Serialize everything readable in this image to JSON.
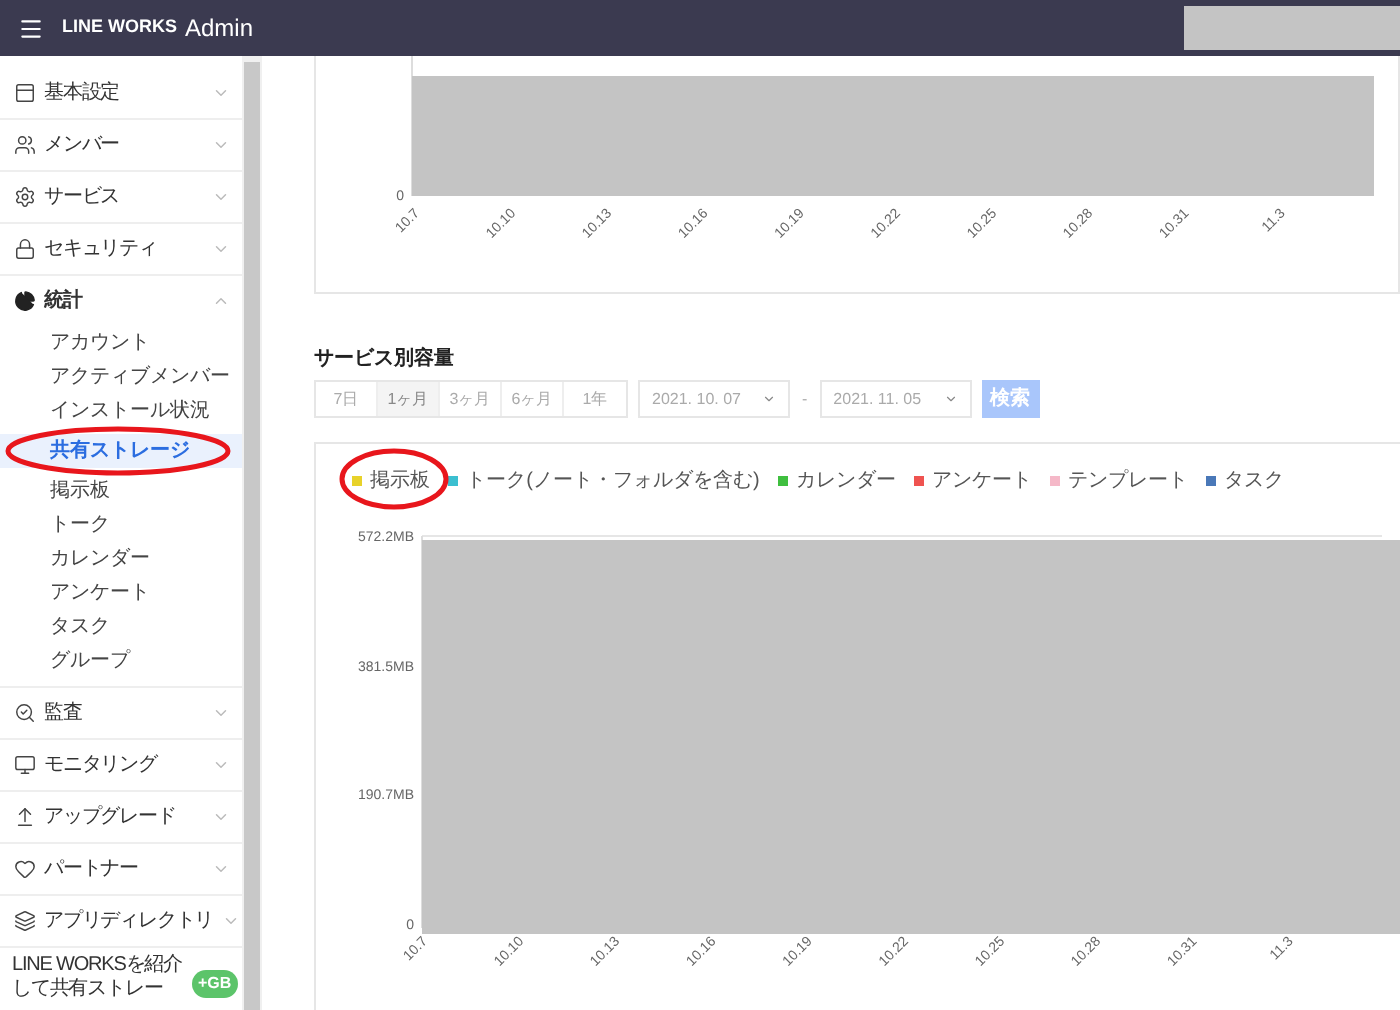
{
  "header": {
    "brand": "LINE WORKS",
    "suffix": "Admin"
  },
  "sidebar": {
    "items": [
      {
        "label": "基本設定",
        "expanded": false
      },
      {
        "label": "メンバー",
        "expanded": false
      },
      {
        "label": "サービス",
        "expanded": false
      },
      {
        "label": "セキュリティ",
        "expanded": false
      },
      {
        "label": "統計",
        "expanded": true,
        "children": [
          {
            "label": "アカウント",
            "selected": false
          },
          {
            "label": "アクティブメンバー",
            "selected": false
          },
          {
            "label": "インストール状況",
            "selected": false
          },
          {
            "label": "共有ストレージ",
            "selected": true
          },
          {
            "label": "掲示板",
            "selected": false
          },
          {
            "label": "トーク",
            "selected": false
          },
          {
            "label": "カレンダー",
            "selected": false
          },
          {
            "label": "アンケート",
            "selected": false
          },
          {
            "label": "タスク",
            "selected": false
          },
          {
            "label": "グループ",
            "selected": false
          }
        ]
      },
      {
        "label": "監査",
        "expanded": false
      },
      {
        "label": "モニタリング",
        "expanded": false
      },
      {
        "label": "アップグレード",
        "expanded": false
      },
      {
        "label": "パートナー",
        "expanded": false
      },
      {
        "label": "アプリディレクトリ",
        "expanded": false
      }
    ],
    "promo": {
      "text": "LINE WORKSを紹介して共有ストレー",
      "badge": "+GB"
    }
  },
  "top_chart": {
    "y_ticks": [
      "0"
    ],
    "x_ticks": [
      "10.7",
      "10.10",
      "10.13",
      "10.16",
      "10.19",
      "10.22",
      "10.25",
      "10.28",
      "10.31",
      "11.3"
    ]
  },
  "section_title": "サービス別容量",
  "range_buttons": [
    {
      "label": "7日",
      "selected": false
    },
    {
      "label": "1ヶ月",
      "selected": true
    },
    {
      "label": "3ヶ月",
      "selected": false
    },
    {
      "label": "6ヶ月",
      "selected": false
    },
    {
      "label": "1年",
      "selected": false
    }
  ],
  "date_from": "2021. 10. 07",
  "separator": "-",
  "date_to": "2021. 11. 05",
  "search_button": {
    "label": "検索",
    "disabled": true
  },
  "legend": [
    {
      "label": "掲示板",
      "color": "#e8d22a"
    },
    {
      "label": "トーク(ノート・フォルダを含む)",
      "color": "#3bbfd0"
    },
    {
      "label": "カレンダー",
      "color": "#3fbf3f"
    },
    {
      "label": "アンケート",
      "color": "#ef5350"
    },
    {
      "label": "テンプレート",
      "color": "#f5b8c8"
    },
    {
      "label": "タスク",
      "color": "#4a78b8"
    }
  ],
  "service_chart": {
    "y_ticks": [
      "572.2MB",
      "381.5MB",
      "190.7MB",
      "0"
    ],
    "x_ticks": [
      "10.7",
      "10.10",
      "10.13",
      "10.16",
      "10.19",
      "10.22",
      "10.25",
      "10.28",
      "10.31",
      "11.3"
    ]
  }
}
